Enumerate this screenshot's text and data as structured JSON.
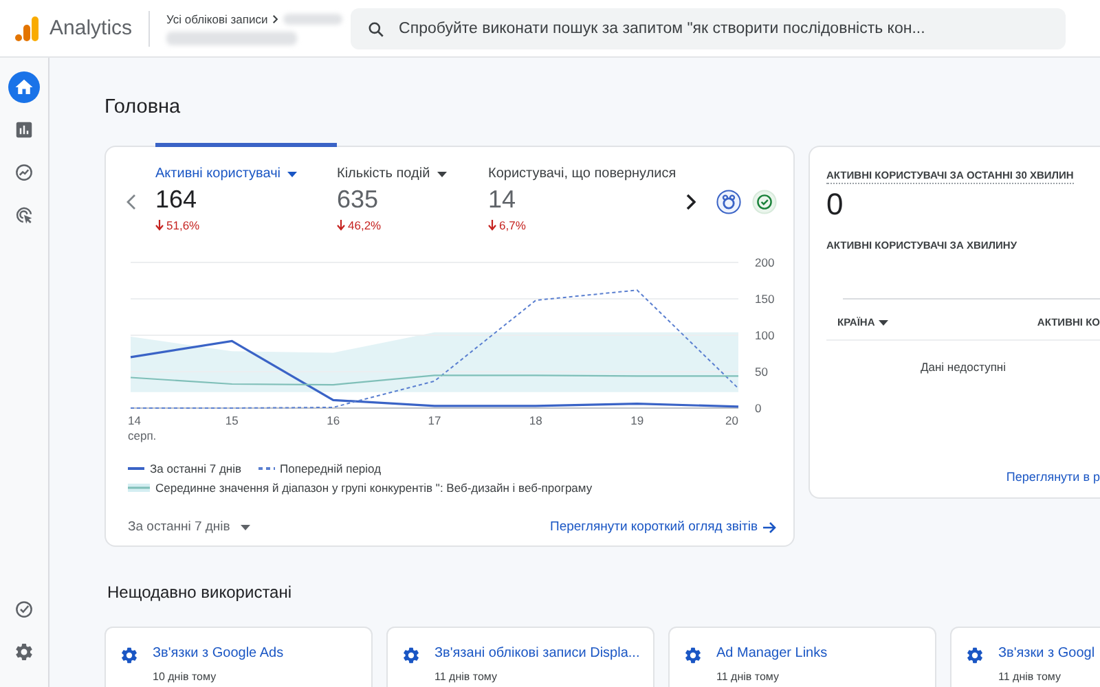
{
  "header": {
    "product": "Analytics",
    "breadcrumb": "Усі облікові записи",
    "search": {
      "placeholder": "Спробуйте виконати пошук за запитом \"як створити послідовність кон..."
    }
  },
  "rail": {
    "top": [
      {
        "kind": "home",
        "selected": true
      },
      {
        "kind": "reports",
        "selected": false
      },
      {
        "kind": "explore",
        "selected": false
      },
      {
        "kind": "advertising",
        "selected": false
      }
    ],
    "bottom": [
      {
        "kind": "check"
      },
      {
        "kind": "settings"
      }
    ]
  },
  "page_title": "Головна",
  "overview": {
    "metrics": [
      {
        "label": "Активні користувачі",
        "value": "164",
        "change": "51,6%",
        "dropdown": true,
        "selected": true
      },
      {
        "label": "Кількість подій",
        "value": "635",
        "change": "46,2%",
        "dropdown": true,
        "selected": false
      },
      {
        "label": "Користувачі, що повернулися",
        "value": "14",
        "change": "6,7%",
        "dropdown": false,
        "selected": false
      }
    ],
    "chart_data": {
      "type": "line",
      "categories": [
        "14",
        "15",
        "16",
        "17",
        "18",
        "19",
        "20"
      ],
      "yticks": [
        0,
        50,
        100,
        150,
        200
      ],
      "ylim": [
        0,
        200
      ],
      "grid": true,
      "series": [
        {
          "name": "За останні 7 днів",
          "color": "#3a63c6",
          "line_style": "solid",
          "values": [
            70,
            92,
            11,
            3,
            3,
            6,
            2
          ]
        },
        {
          "name": "Попередній період",
          "color": "#5a7fd0",
          "line_style": "dashed",
          "values": [
            0,
            0,
            1,
            37,
            148,
            162,
            27
          ]
        },
        {
          "name": "Серединне значення й діапазон у групі конкурентів \": Веб-дизайн і веб-програму",
          "color": "#7fbfb8",
          "line_style": "solid",
          "values": [
            42,
            33,
            32,
            45,
            45,
            44,
            44
          ]
        }
      ],
      "annotations": [
        "серп."
      ]
    },
    "period": "За останні 7 днів",
    "link": "Переглянути короткий огляд звітів"
  },
  "realtime": {
    "title": "АКТИВНІ КОРИСТУВАЧІ ЗА ОСТАННІ 30 ХВИЛИН",
    "value": "0",
    "subtitle": "АКТИВНІ КОРИСТУВАЧІ ЗА ХВИЛИНУ",
    "columns": [
      "КРАЇНА",
      "АКТИВНІ КО"
    ],
    "empty": "Дані недоступні",
    "link": "Переглянути в р"
  },
  "recent": {
    "title": "Нещодавно використані",
    "items": [
      {
        "title": "Зв'язки з Google Ads",
        "time": "10 днів тому"
      },
      {
        "title": "Зв'язані облікові записи Displa...",
        "time": "11 днів тому"
      },
      {
        "title": "Ad Manager Links",
        "time": "11 днів тому"
      },
      {
        "title": "Зв'язки з Googl",
        "time": "11 днів тому"
      }
    ]
  }
}
